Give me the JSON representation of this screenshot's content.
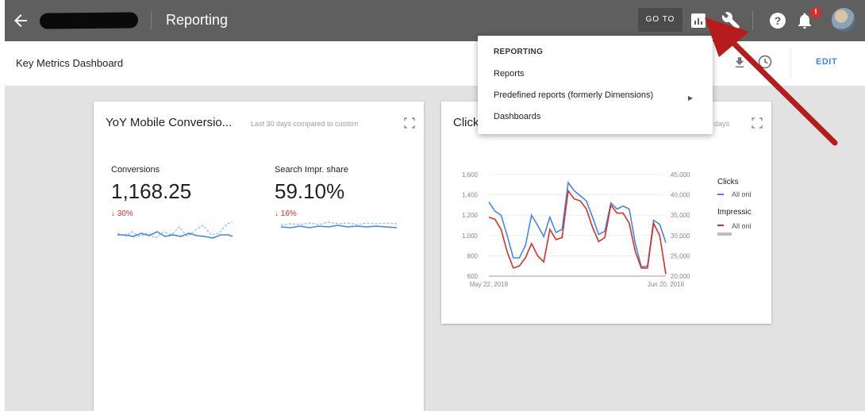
{
  "topbar": {
    "title": "Reporting",
    "goto_label": "GO TO",
    "notification_count": "!"
  },
  "subbar": {
    "dashboard_title": "Key Metrics Dashboard",
    "edit_label": "EDIT"
  },
  "menu": {
    "header": "REPORTING",
    "items": [
      {
        "label": "Reports"
      },
      {
        "label": "Predefined reports (formerly Dimensions)"
      },
      {
        "label": "Dashboards"
      }
    ]
  },
  "card1": {
    "title": "YoY Mobile Conversio...",
    "subtitle": "Last 30 days compared to custom",
    "metrics": [
      {
        "label": "Conversions",
        "value": "1,168.25",
        "change": "30%"
      },
      {
        "label": "Search Impr. share",
        "value": "59.10%",
        "change": "16%"
      }
    ]
  },
  "card2": {
    "title": "Click",
    "subtitle": "days",
    "legend": {
      "clicks_header": "Clicks",
      "clicks_series": "All onl",
      "impr_header": "Impressic",
      "impr_series": "All onl"
    }
  },
  "colors": {
    "topbar": "#5f5f5f",
    "accent_blue": "#4285f4",
    "accent_red": "#d93025",
    "arrow": "#b71c1c"
  },
  "chart_data": {
    "type": "line",
    "x_tick_labels": [
      "May 22, 2018",
      "Jun 20, 2018"
    ],
    "y_left_ticks": [
      600,
      800,
      "1,000",
      "1,200",
      "1,400",
      "1,600"
    ],
    "y_right_ticks": [
      "20,000",
      "25,000",
      "30,000",
      "35,000",
      "40,000",
      "45,000"
    ],
    "ylim_left": [
      600,
      1600
    ],
    "ylim_right": [
      20000,
      45000
    ],
    "series": [
      {
        "name": "All onl",
        "axis": "left",
        "color": "#4285f4",
        "values": [
          1330,
          1240,
          1200,
          1000,
          780,
          780,
          900,
          1200,
          1100,
          990,
          1180,
          1030,
          1060,
          1520,
          1440,
          1390,
          1340,
          1180,
          1010,
          1040,
          1320,
          1260,
          1290,
          1260,
          920,
          690,
          700,
          1150,
          1110,
          930
        ]
      },
      {
        "name": "All onl",
        "axis": "right",
        "color": "#d93025",
        "values": [
          34500,
          34000,
          31500,
          26000,
          22000,
          22500,
          24500,
          28000,
          25000,
          23500,
          31500,
          29000,
          29500,
          41000,
          39000,
          38500,
          36500,
          32000,
          28500,
          29500,
          37500,
          35500,
          35500,
          33000,
          26000,
          22000,
          22000,
          33000,
          30000,
          20500
        ]
      }
    ]
  }
}
